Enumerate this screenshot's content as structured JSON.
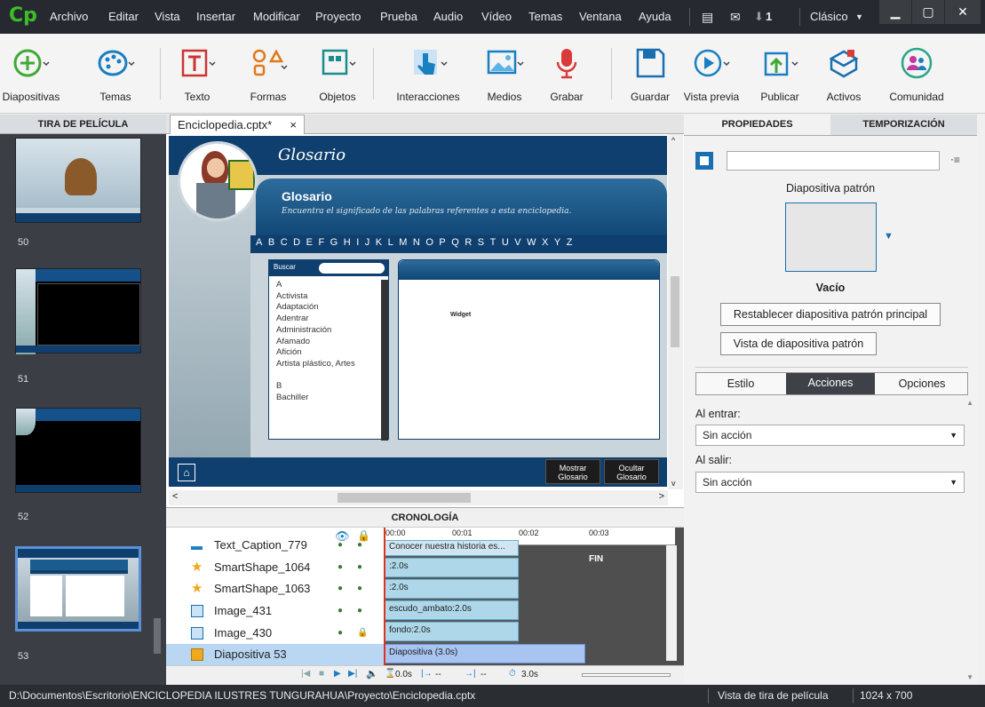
{
  "app": {
    "logo": "Cp"
  },
  "menu": [
    "Archivo",
    "Editar",
    "Vista",
    "Insertar",
    "Modificar",
    "Proyecto",
    "Prueba",
    "Audio",
    "Vídeo",
    "Temas",
    "Ventana",
    "Ayuda"
  ],
  "menubar_right": {
    "notification_count": "1",
    "workspace": "Clásico"
  },
  "toolbar": {
    "diapositivas": "Diapositivas",
    "temas": "Temas",
    "texto": "Texto",
    "formas": "Formas",
    "objetos": "Objetos",
    "interacciones": "Interacciones",
    "medios": "Medios",
    "grabar": "Grabar",
    "guardar": "Guardar",
    "vista_previa": "Vista previa",
    "publicar": "Publicar",
    "activos": "Activos",
    "comunidad": "Comunidad"
  },
  "filmstrip": {
    "header": "TIRA DE PELÍCULA",
    "slides": [
      {
        "num": "50"
      },
      {
        "num": "51"
      },
      {
        "num": "52"
      },
      {
        "num": "53"
      }
    ]
  },
  "document": {
    "tab_title": "Enciclopedia.cptx*",
    "close": "×"
  },
  "slide": {
    "header_title": "Glosario",
    "panel_title": "Glosario",
    "panel_subtitle": "Encuentra el significado de las palabras referentes a esta enciclopedia.",
    "alphabet": [
      "A",
      "B",
      "C",
      "D",
      "E",
      "F",
      "G",
      "H",
      "I",
      "J",
      "K",
      "L",
      "M",
      "N",
      "O",
      "P",
      "Q",
      "R",
      "S",
      "T",
      "U",
      "V",
      "W",
      "X",
      "Y",
      "Z"
    ],
    "search_label": "Buscar",
    "terms": [
      "A",
      "Activista",
      "Adaptación",
      "Adentrar",
      "Administración",
      "Afamado",
      "Afición",
      "Artista plástico, Artes",
      "",
      "B",
      "Bachiller"
    ],
    "widget_label": "Widget",
    "btn_mostrar": "Mostrar Glosario",
    "btn_ocultar": "Ocultar Glosario"
  },
  "timeline": {
    "header": "CRONOLOGÍA",
    "ticks": [
      "00:00",
      "00:01",
      "00:02",
      "00:03"
    ],
    "end_label": "FIN",
    "rows": [
      {
        "name": "Text_Caption_779",
        "bar": "Conocer nuestra historia es..."
      },
      {
        "name": "SmartShape_1064",
        "bar": ":2.0s"
      },
      {
        "name": "SmartShape_1063",
        "bar": ":2.0s"
      },
      {
        "name": "Image_431",
        "bar": "escudo_ambato:2.0s"
      },
      {
        "name": "Image_430",
        "bar": "fondo:2.0s"
      },
      {
        "name": "Diapositiva 53",
        "bar": "Diapositiva (3.0s)"
      }
    ],
    "controls": {
      "time1": "0.0s",
      "time2": "--",
      "time3": "--",
      "duration": "3.0s"
    }
  },
  "properties": {
    "tab_props": "PROPIEDADES",
    "tab_timing": "TEMPORIZACIÓN",
    "name_value": "",
    "master_label": "Diapositiva patrón",
    "master_name": "Vacío",
    "btn_reset": "Restablecer diapositiva patrón principal",
    "btn_view": "Vista de diapositiva patrón",
    "subtabs": [
      "Estilo",
      "Acciones",
      "Opciones"
    ],
    "on_enter_label": "Al entrar:",
    "on_enter_value": "Sin acción",
    "on_exit_label": "Al salir:",
    "on_exit_value": "Sin acción"
  },
  "status": {
    "path": "D:\\Documentos\\Escritorio\\ENCICLOPEDIA ILUSTRES TUNGURAHUA\\Proyecto\\Enciclopedia.cptx",
    "view": "Vista de tira de película",
    "size": "1024 x 700"
  }
}
